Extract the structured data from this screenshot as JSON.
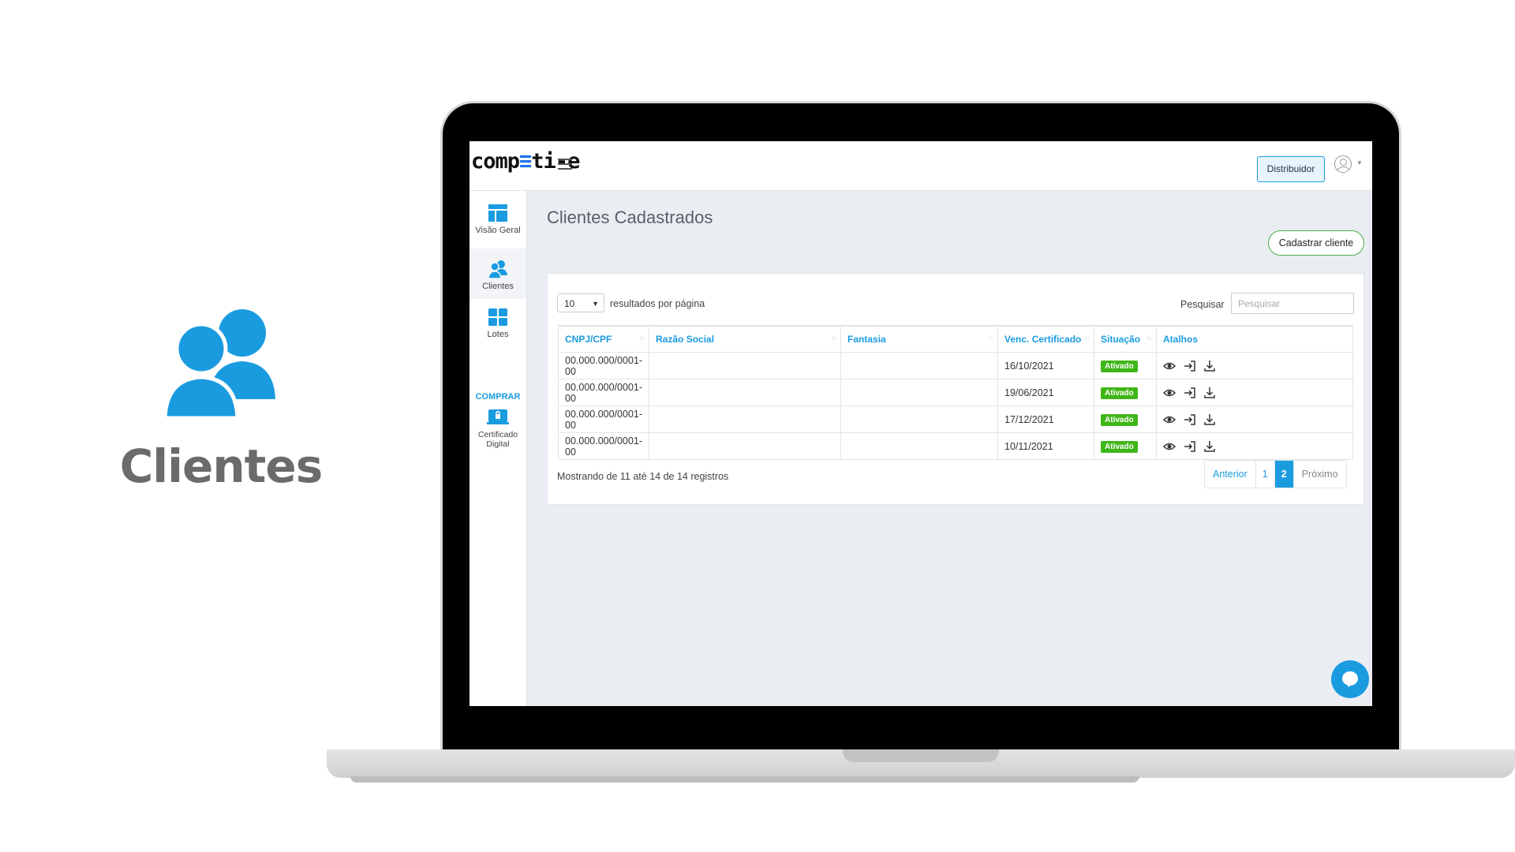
{
  "promo": {
    "label": "Clientes",
    "icon": "users-icon",
    "color": "#1a9be0"
  },
  "app": {
    "logo_prefix": "comp",
    "logo_accent": "≡",
    "logo_suffix": "ti-e",
    "distribuidor_label": "Distribuidor"
  },
  "sidebar": {
    "items": [
      {
        "label": "Visão Geral",
        "icon": "dashboard-icon"
      },
      {
        "label": "Clientes",
        "icon": "users-icon"
      },
      {
        "label": "Lotes",
        "icon": "grid-icon"
      }
    ],
    "comprar_label": "COMPRAR",
    "certificado_label_1": "Certificado",
    "certificado_label_2": "Digital"
  },
  "main": {
    "title": "Clientes Cadastrados",
    "cadastrar_label": "Cadastrar cliente",
    "page_size": "10",
    "page_size_label": "resultados por página",
    "search_label": "Pesquisar",
    "search_placeholder": "Pesquisar",
    "columns": [
      "CNPJ/CPF",
      "Razão Social",
      "Fantasia",
      "Venc. Certificado",
      "Situação",
      "Atalhos"
    ],
    "rows": [
      {
        "cnpj": "00.000.000/0001-00",
        "razao": "",
        "fantasia": "",
        "venc": "16/10/2021",
        "situacao": "Ativado"
      },
      {
        "cnpj": "00.000.000/0001-00",
        "razao": "",
        "fantasia": "",
        "venc": "19/06/2021",
        "situacao": "Ativado"
      },
      {
        "cnpj": "00.000.000/0001-00",
        "razao": "",
        "fantasia": "",
        "venc": "17/12/2021",
        "situacao": "Ativado"
      },
      {
        "cnpj": "00.000.000/0001-00",
        "razao": "",
        "fantasia": "",
        "venc": "10/11/2021",
        "situacao": "Ativado"
      }
    ],
    "footer_info": "Mostrando de 11 até 14 de 14 registros",
    "pager": {
      "prev": "Anterior",
      "pages": [
        "1",
        "2"
      ],
      "current": "2",
      "next": "Próximo"
    }
  },
  "colors": {
    "accent": "#1a9be0",
    "success": "#3fb618",
    "outline_green": "#4caf50"
  }
}
